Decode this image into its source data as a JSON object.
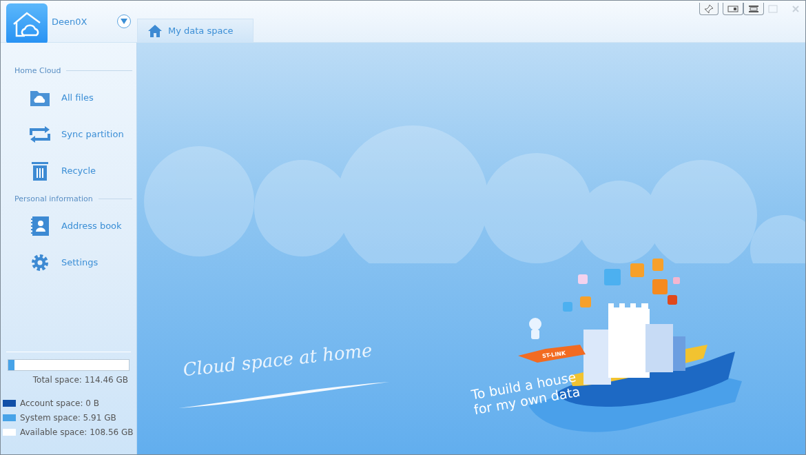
{
  "user": {
    "name": "Deen0X"
  },
  "tabs": [
    {
      "label": "My data space",
      "selected": true
    }
  ],
  "sidebar": {
    "sections": [
      {
        "title": "Home Cloud",
        "items": [
          {
            "label": "All files",
            "kind": "folder",
            "selected": false
          },
          {
            "label": "Sync partition",
            "kind": "sync",
            "selected": false
          },
          {
            "label": "Recycle",
            "kind": "trash",
            "selected": false
          }
        ]
      },
      {
        "title": "Personal information",
        "items": [
          {
            "label": "Address book",
            "kind": "contacts",
            "selected": false
          },
          {
            "label": "Settings",
            "kind": "settings",
            "selected": false
          }
        ]
      }
    ]
  },
  "storage": {
    "level": 0.05,
    "total": "Total space: 114.46 GB",
    "legend": [
      {
        "label": "Account space: 0 B",
        "color": "#1150a8"
      },
      {
        "label": "System space: 5.91 GB",
        "color": "#47a3e8"
      },
      {
        "label": "Available space: 108.56 GB",
        "color": "#ffffff"
      }
    ]
  },
  "banner": {
    "slogan": "Cloud space at home",
    "tagline": [
      "To build a house",
      "for my own data"
    ],
    "flag": "ST-LINK"
  }
}
